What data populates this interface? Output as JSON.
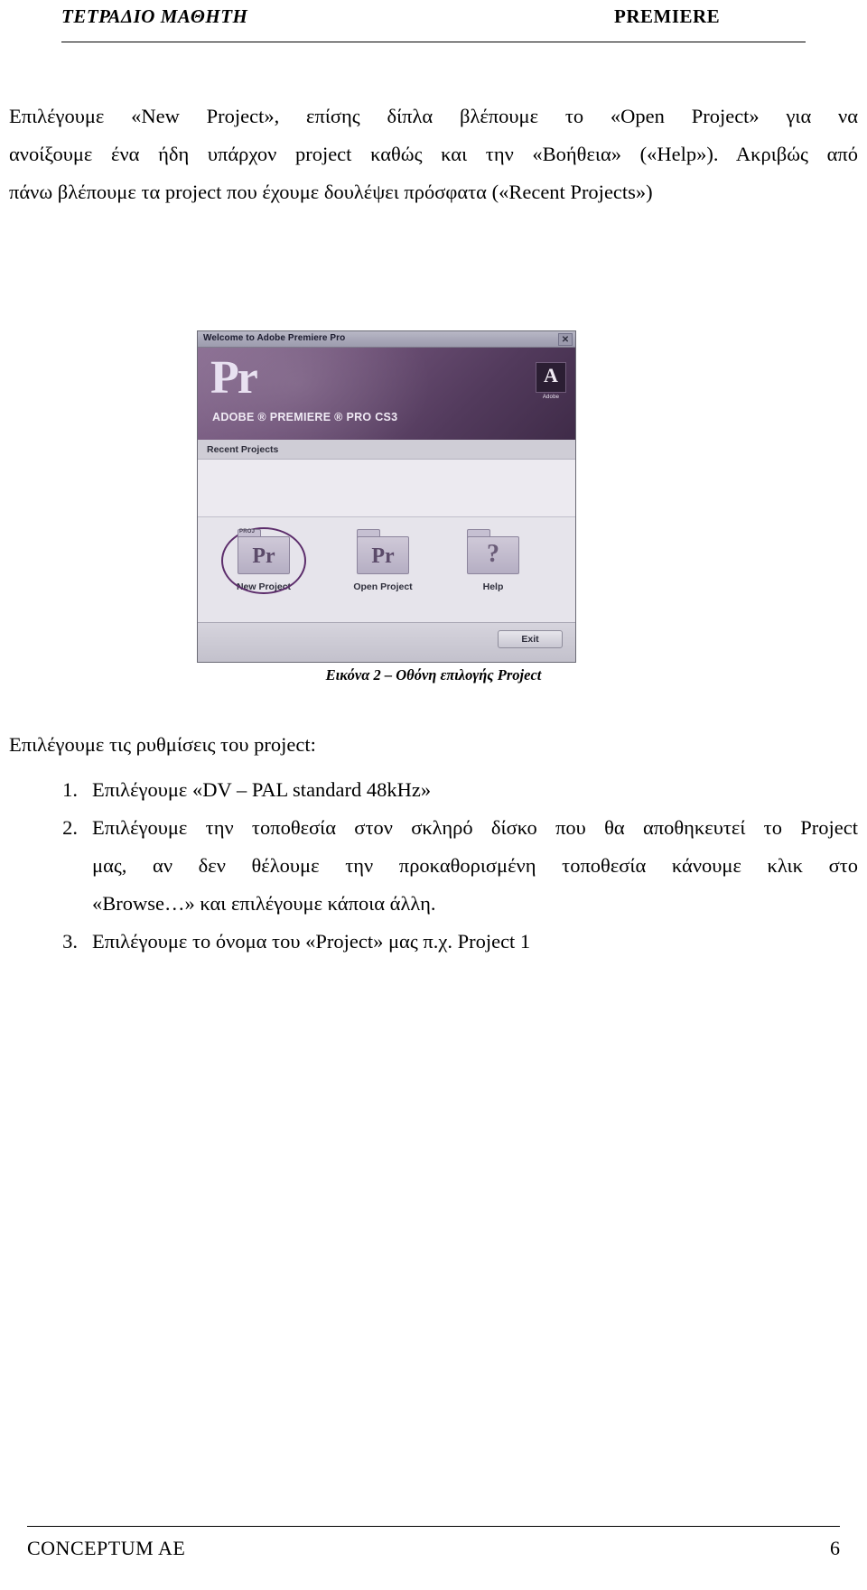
{
  "header": {
    "left": "ΤΕΤΡΑΔΙΟ ΜΑΘΗΤΗ",
    "right": "PREMIERE"
  },
  "intro_paragraph": {
    "line1": "Επιλέγουμε «New Project», επίσης δίπλα βλέπουμε το «Open Project» για να",
    "line2": "ανοίξουμε ένα ήδη υπάρχον project καθώς και την «Βοήθεια» («Help»). Ακριβώς από",
    "line3": "πάνω βλέπουμε τα project που έχουμε δουλέψει πρόσφατα («Recent Projects»)"
  },
  "figure": {
    "window_title": "Welcome to Adobe Premiere Pro",
    "close_label": "✕",
    "logo_text": "Pr",
    "banner_subtitle": "ADOBE ® PREMIERE ® PRO CS3",
    "adobe_glyph": "A",
    "adobe_word": "Adobe",
    "recent_projects_label": "Recent Projects",
    "actions": [
      {
        "icon": "new-project-icon",
        "glyph": "Pr",
        "tab_label": "PROJ",
        "label": "New Project",
        "selected": true
      },
      {
        "icon": "open-project-icon",
        "glyph": "Pr",
        "tab_label": "",
        "label": "Open Project",
        "selected": false
      },
      {
        "icon": "help-icon",
        "glyph": "?",
        "tab_label": "",
        "label": "Help",
        "selected": false
      }
    ],
    "exit_label": "Exit",
    "caption": "Εικόνα 2 – Οθόνη επιλογής Project"
  },
  "settings_section": {
    "lead": "Επιλέγουμε τις ρυθμίσεις του project:",
    "items": [
      {
        "number": "1.",
        "line1": "Επιλέγουμε «DV – PAL standard 48kHz»"
      },
      {
        "number": "2.",
        "line1": "Επιλέγουμε την τοποθεσία στον σκληρό δίσκο που θα αποθηκευτεί το Project",
        "line2": "μας, αν δεν θέλουμε την προκαθορισμένη τοποθεσία κάνουμε κλικ στο",
        "line3": "«Browse…» και επιλέγουμε κάποια άλλη."
      },
      {
        "number": "3.",
        "line1": "Επιλέγουμε το όνομα του «Project» μας π.χ. Project 1"
      }
    ]
  },
  "footer": {
    "left": "CONCEPTUM AE",
    "page_number": "6"
  }
}
